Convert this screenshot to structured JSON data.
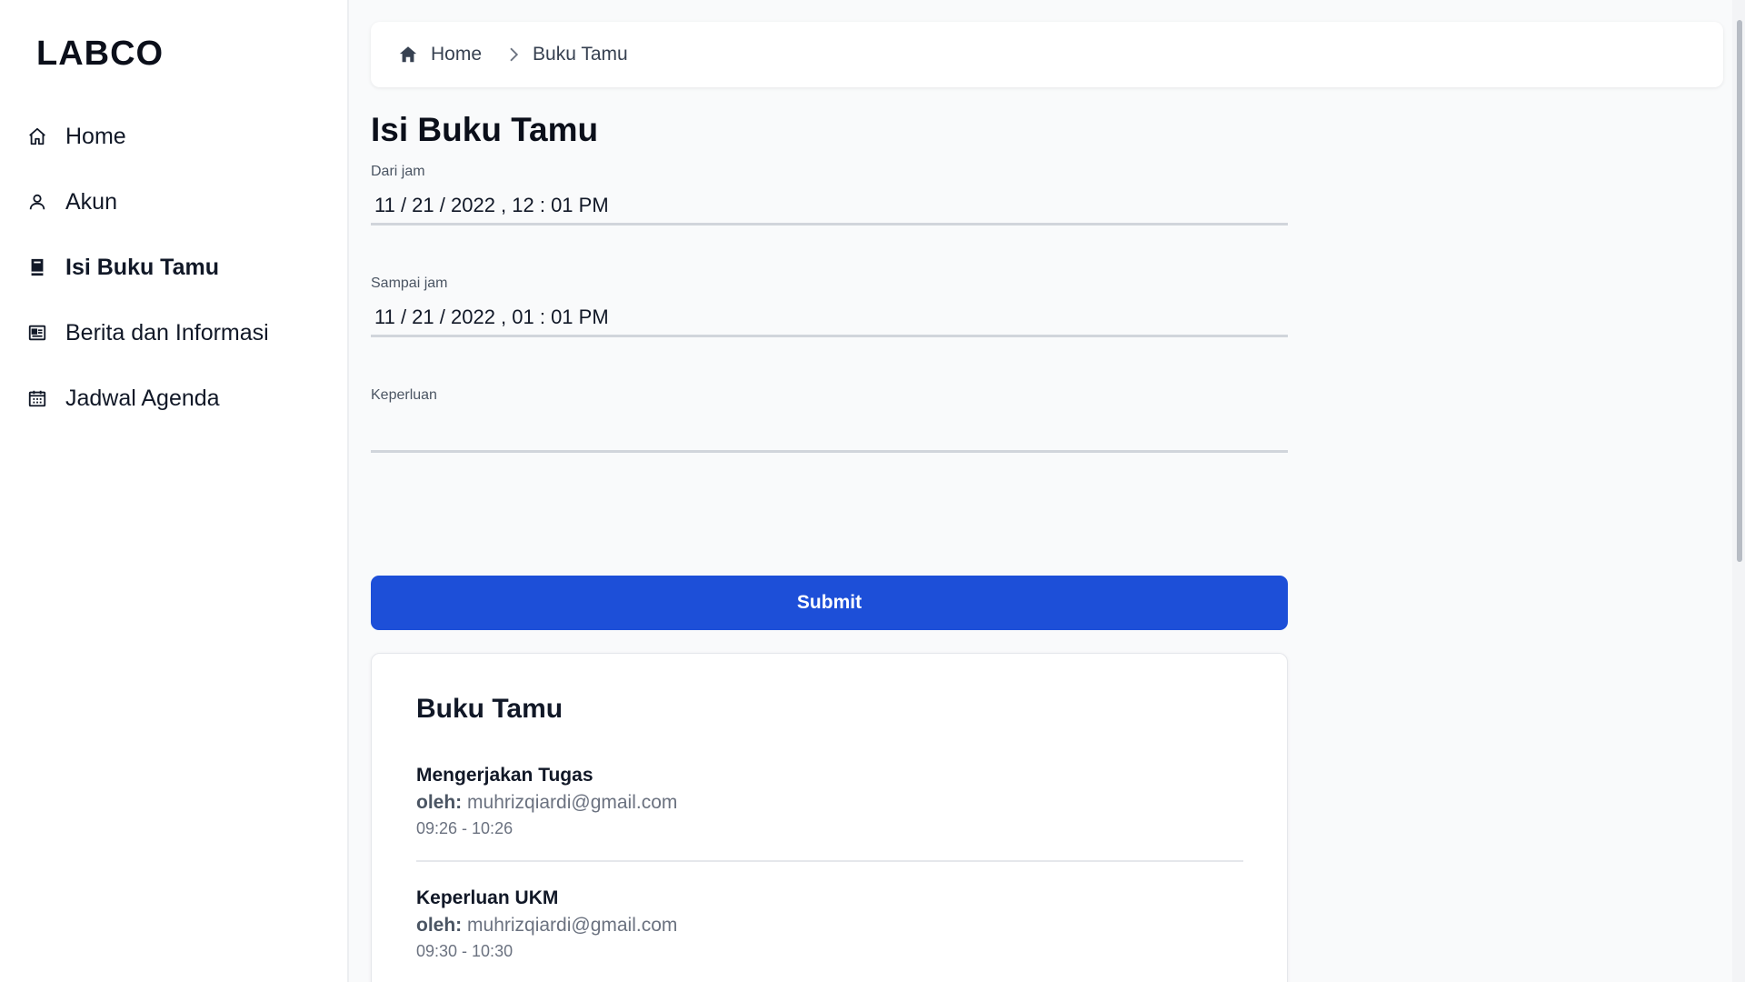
{
  "sidebar": {
    "brand": "LABCO",
    "items": [
      {
        "label": "Home",
        "icon": "home-icon"
      },
      {
        "label": "Akun",
        "icon": "user-icon"
      },
      {
        "label": "Isi Buku Tamu",
        "icon": "book-icon",
        "active": true
      },
      {
        "label": "Berita dan Informasi",
        "icon": "newspaper-icon"
      },
      {
        "label": "Jadwal Agenda",
        "icon": "calendar-icon"
      }
    ]
  },
  "breadcrumb": {
    "home": "Home",
    "current": "Buku Tamu"
  },
  "page": {
    "title": "Isi Buku Tamu"
  },
  "form": {
    "from_label": "Dari jam",
    "from_value": "11 / 21 / 2022 ,  12 : 01   PM",
    "to_label": "Sampai jam",
    "to_value": "11 / 21 / 2022 ,  01 : 01   PM",
    "purpose_label": "Keperluan",
    "purpose_value": "",
    "submit_label": "Submit"
  },
  "guestbook": {
    "title": "Buku Tamu",
    "by_label": "oleh:",
    "entries": [
      {
        "title": "Mengerjakan Tugas",
        "email": "muhrizqiardi@gmail.com",
        "time": "09:26 - 10:26"
      },
      {
        "title": "Keperluan UKM",
        "email": "muhrizqiardi@gmail.com",
        "time": "09:30 - 10:30"
      }
    ]
  },
  "colors": {
    "accent": "#1d4fd8",
    "text": "#111827",
    "muted": "#6b7280"
  }
}
